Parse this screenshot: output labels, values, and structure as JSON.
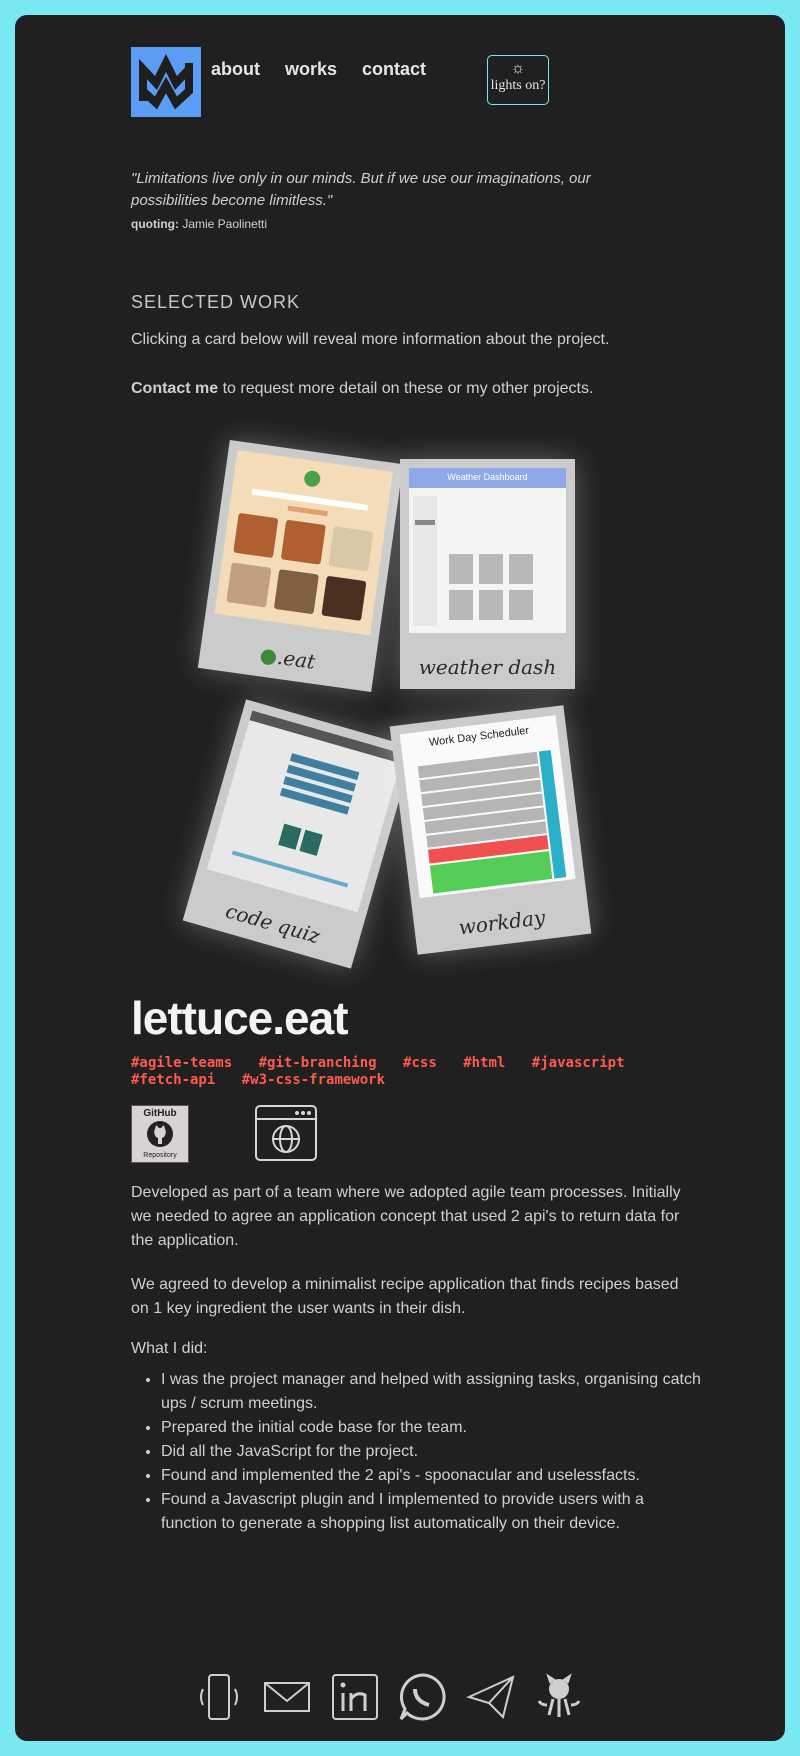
{
  "nav": {
    "about": "about",
    "works": "works",
    "contact": "contact"
  },
  "lights_btn": {
    "icon": "☼",
    "label": "lights on?"
  },
  "quote": {
    "text": "\"Limitations live only in our minds. But if we use our imaginations, our possibilities become limitless.\"",
    "by_label": "quoting:",
    "by_name": "Jamie Paolinetti"
  },
  "selected": {
    "title": "SELECTED WORK",
    "intro": "Clicking a card below will reveal more information about the project.",
    "contact_bold": "Contact me",
    "contact_rest": " to request more detail on these or my other projects."
  },
  "cards": [
    {
      "label": ".eat"
    },
    {
      "label": "weather dash",
      "screen_title": "Weather Dashboard"
    },
    {
      "label": "code quiz"
    },
    {
      "label": "workday",
      "screen_title": "Work Day Scheduler"
    }
  ],
  "project": {
    "title": "lettuce.eat",
    "tags": [
      "#agile-teams",
      "#git-branching",
      "#css",
      "#html",
      "#javascript",
      "#fetch-api",
      "#w3-css-framework"
    ],
    "github": {
      "top": "GitHub",
      "bottom": "Repository"
    },
    "p1": "Developed as part of a team where we adopted agile team processes. Initially we needed to agree an application concept that used 2 api's to return data for the application.",
    "p2": "We agreed to develop a minimalist recipe application that finds recipes based on 1 key ingredient the user wants in their dish.",
    "did_label": "What I did:",
    "did": [
      "I was the project manager and helped with assigning tasks, organising catch ups / scrum meetings.",
      "Prepared the initial code base for the team.",
      "Did all the JavaScript for the project.",
      "Found and implemented the 2 api's - spoonacular and uselessfacts.",
      "Found a Javascript plugin and I implemented to provide users with a function to generate a shopping list automatically on their device."
    ]
  },
  "colors": {
    "frame": "#7ae8f3",
    "bg": "#212020",
    "logo": "#5b9cf5",
    "tags": "#ff5a4e"
  }
}
